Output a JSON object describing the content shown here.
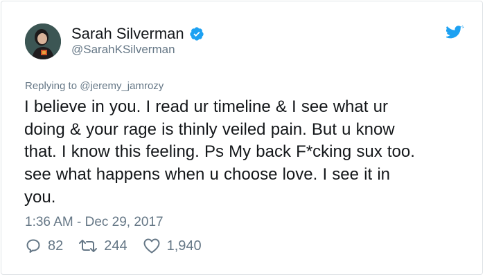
{
  "tweet": {
    "author": {
      "display_name": "Sarah Silverman",
      "handle": "@SarahKSilverman",
      "verified": true
    },
    "reply_to": "Replying to @jeremy_jamrozy",
    "text_lines": [
      "I believe in you. I read ur timeline & I see what ur",
      "doing & your rage is thinly veiled pain. But u know",
      "that. I know this feeling. Ps My back F*cking sux too.",
      "see what happens when u choose love. I see it in",
      "you."
    ],
    "timestamp": "1:36 AM - Dec 29, 2017",
    "stats": {
      "replies": "82",
      "retweets": "244",
      "likes": "1,940"
    }
  },
  "colors": {
    "twitter_blue": "#1da1f2",
    "text_primary": "#14171a",
    "text_secondary": "#657786"
  },
  "icons": {
    "platform": "twitter-bird-icon",
    "verified": "verified-badge-icon",
    "reply": "reply-icon",
    "retweet": "retweet-icon",
    "like": "heart-icon"
  }
}
